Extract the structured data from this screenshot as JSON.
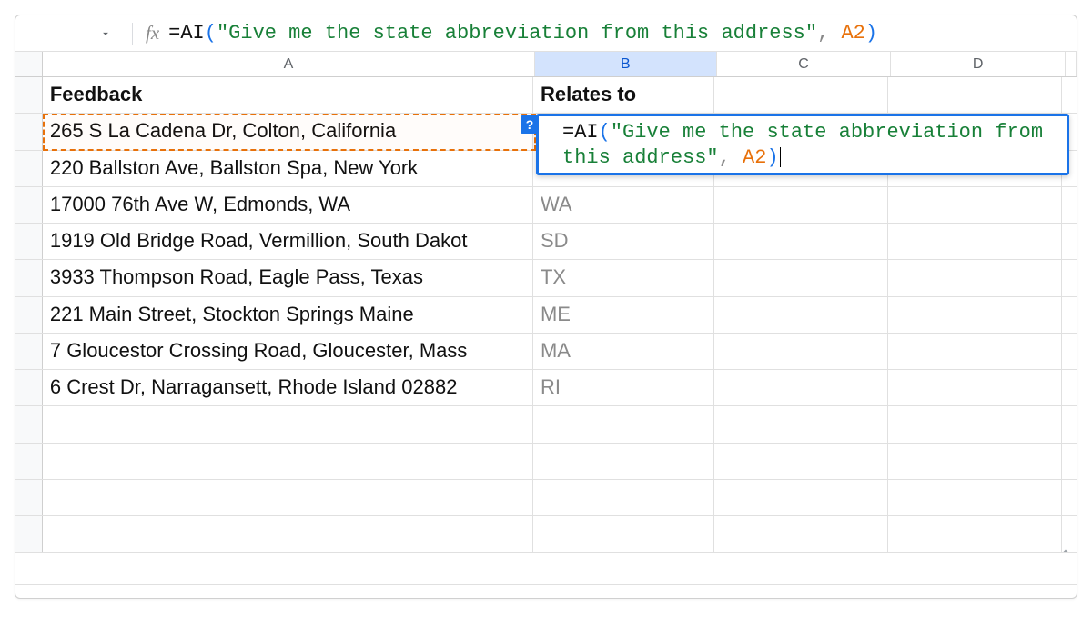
{
  "formula_bar": {
    "fx_label": "fx",
    "tokens": {
      "eq": "=",
      "fn": "AI",
      "open": "(",
      "str": "\"Give me the state abbreviation from this address\"",
      "comma": ",",
      "ref": " A2",
      "close": ")"
    }
  },
  "columns": {
    "A": "A",
    "B": "B",
    "C": "C",
    "D": "D"
  },
  "headers": {
    "feedback": "Feedback",
    "relates_to": "Relates to"
  },
  "active_cell": {
    "help_badge": "?",
    "tokens": {
      "eq": "=",
      "fn": "AI",
      "open": "(",
      "str1": "\"Give me the state abbreviation from ",
      "str2": "this address\"",
      "comma": ",",
      "ref": " A2",
      "close": ")"
    }
  },
  "rows": [
    {
      "address": "265 S La Cadena Dr, Colton, California",
      "value": ""
    },
    {
      "address": "220 Ballston Ave, Ballston Spa, New York",
      "value": ""
    },
    {
      "address": "17000 76th Ave W, Edmonds, WA",
      "value": "WA"
    },
    {
      "address": "1919 Old Bridge Road, Vermillion, South Dakot",
      "value": "SD"
    },
    {
      "address": "3933 Thompson Road, Eagle Pass, Texas",
      "value": "TX"
    },
    {
      "address": "221 Main Street, Stockton Springs Maine",
      "value": "ME"
    },
    {
      "address": "7 Gloucestor Crossing Road, Gloucester, Mass",
      "value": "MA"
    },
    {
      "address": "6 Crest Dr, Narragansett, Rhode Island 02882",
      "value": "RI"
    }
  ]
}
